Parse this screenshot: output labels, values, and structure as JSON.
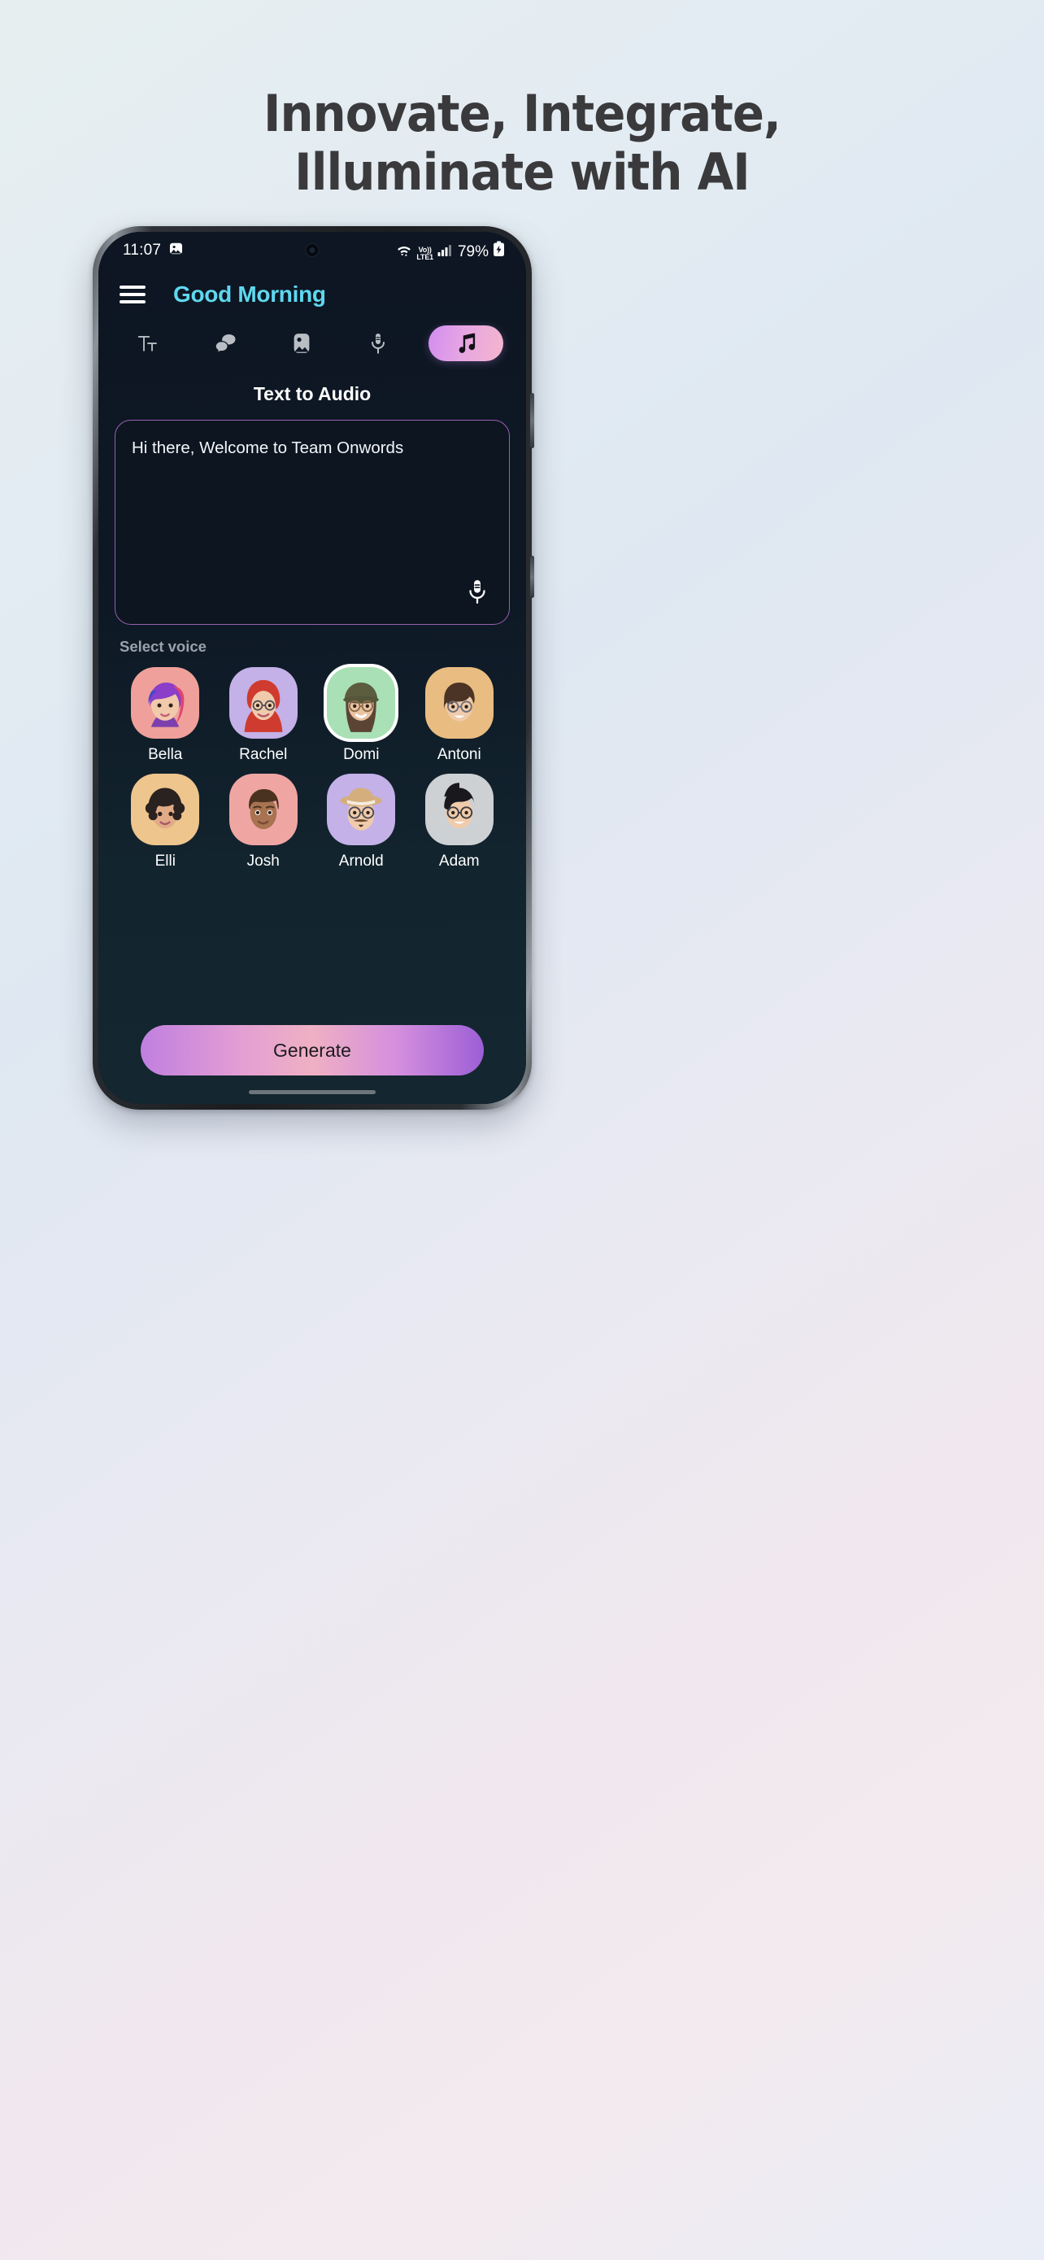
{
  "promo": {
    "headline_line1": "Innovate, Integrate,",
    "headline_line2": "Illuminate with AI"
  },
  "status_bar": {
    "time": "11:07",
    "image_icon": "image-icon",
    "wifi_icon": "wifi-icon",
    "volte_top": "Vo))",
    "volte_bottom": "LTE1",
    "signal_icon": "cellular-signal-icon",
    "battery_percent": "79%",
    "battery_icon": "battery-charging-icon"
  },
  "app_bar": {
    "menu_icon": "hamburger-menu-icon",
    "greeting": "Good Morning"
  },
  "tabs": [
    {
      "id": "text",
      "icon": "text-format-icon",
      "active": false
    },
    {
      "id": "chat",
      "icon": "chat-bubbles-icon",
      "active": false
    },
    {
      "id": "image",
      "icon": "image-icon",
      "active": false
    },
    {
      "id": "voice",
      "icon": "microphone-icon",
      "active": false
    },
    {
      "id": "music",
      "icon": "music-note-icon",
      "active": true
    }
  ],
  "main": {
    "section_title": "Text to Audio",
    "textarea_value": "Hi there, Welcome to Team Onwords",
    "textarea_mic_icon": "microphone-icon",
    "select_voice_label": "Select voice"
  },
  "voices": [
    {
      "name": "Bella",
      "bg": "#efa09a",
      "selected": false
    },
    {
      "name": "Rachel",
      "bg": "#c3b1e8",
      "selected": false
    },
    {
      "name": "Domi",
      "bg": "#a9e0b5",
      "selected": true
    },
    {
      "name": "Antoni",
      "bg": "#e9bc81",
      "selected": false
    },
    {
      "name": "Elli",
      "bg": "#eec58d",
      "selected": false
    },
    {
      "name": "Josh",
      "bg": "#efa6a3",
      "selected": false
    },
    {
      "name": "Arnold",
      "bg": "#c3b1e8",
      "selected": false
    },
    {
      "name": "Adam",
      "bg": "#cdd1d4",
      "selected": false
    }
  ],
  "actions": {
    "generate_label": "Generate"
  },
  "colors": {
    "accent_cyan": "#5fd8ef",
    "accent_purple": "#9b5fb4",
    "screen_bg": "#0e1724"
  }
}
